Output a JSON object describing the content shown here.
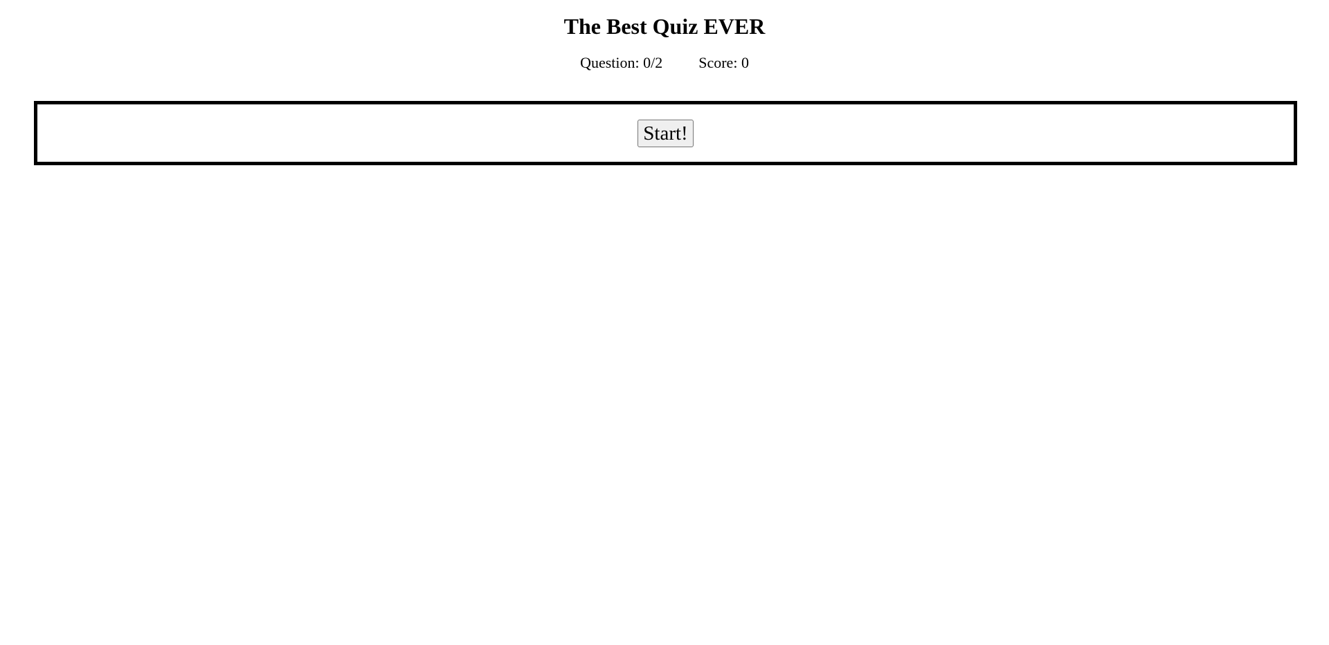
{
  "header": {
    "title": "The Best Quiz EVER"
  },
  "stats": {
    "question_label": "Question: 0/2",
    "score_label": "Score: 0",
    "question_current": 0,
    "question_total": 2,
    "score": 0
  },
  "quiz": {
    "start_label": "Start!"
  }
}
